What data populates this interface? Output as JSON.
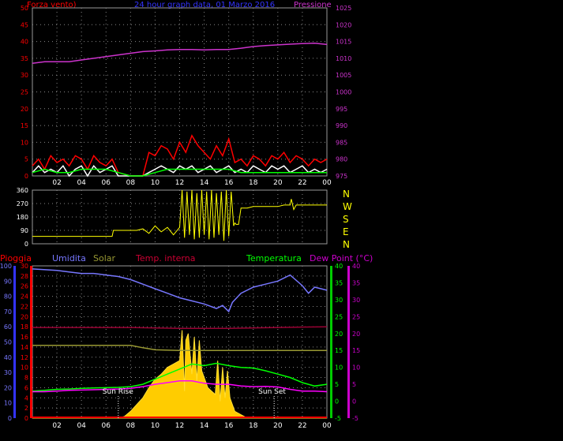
{
  "header": {
    "left_label": "Forza vento)",
    "title": "24 hour graph data, 01 Marzo 2016",
    "right_label": "Pressione"
  },
  "direction_letters": [
    "N",
    "W",
    "S",
    "E",
    "N"
  ],
  "bottom_labels": {
    "pioggia": "Pioggia",
    "umidita": "Umidita",
    "solar": "Solar",
    "temp_interna": "Temp. interna",
    "temperatura": "Temperatura",
    "dew_point": "Dew Point (°C)"
  },
  "annotations": {
    "sun_rise": "Sun Rise",
    "sun_set": "Sun Set"
  },
  "colors": {
    "wind_gust": "#ff0000",
    "wind_avg": "#ffffff",
    "wind_green": "#00ff00",
    "pressure": "#cc33cc",
    "direction": "#ffff00",
    "humidity": "#7777ff",
    "solar_line": "#999933",
    "temp_interna": "#990033",
    "temperatura": "#00ff00",
    "dew_point": "#ff00ff",
    "solar_fill": "#ffcc00",
    "rain": "#ff0000"
  },
  "chart_data": [
    {
      "type": "line",
      "name": "wind_pressure",
      "x_tick_labels": [
        "02",
        "04",
        "06",
        "08",
        "10",
        "12",
        "14",
        "16",
        "18",
        "20",
        "22",
        "00"
      ],
      "y_left_ticks": [
        "0",
        "5",
        "10",
        "15",
        "20",
        "25",
        "30",
        "35",
        "40",
        "45",
        "50"
      ],
      "y_right_ticks": [
        "975",
        "980",
        "985",
        "990",
        "995",
        "1000",
        "1005",
        "1010",
        "1015",
        "1020",
        "1025"
      ],
      "ylim_left": [
        0,
        50
      ],
      "ylim_right": [
        975,
        1025
      ],
      "xlim_hours": [
        0,
        24
      ],
      "grid": true,
      "series": [
        {
          "key": "pressure",
          "axis": "right",
          "x": [
            0,
            1,
            2,
            3,
            4,
            5,
            6,
            7,
            8,
            9,
            10,
            11,
            12,
            13,
            14,
            15,
            16,
            17,
            18,
            19,
            20,
            21,
            22,
            23,
            24
          ],
          "values": [
            1008.5,
            1009,
            1009,
            1009,
            1009.5,
            1010,
            1010.5,
            1011,
            1011.5,
            1012,
            1012.2,
            1012.5,
            1012.6,
            1012.6,
            1012.5,
            1012.6,
            1012.6,
            1013,
            1013.5,
            1013.8,
            1014,
            1014.2,
            1014.4,
            1014.5,
            1014.1
          ]
        },
        {
          "key": "wind_gust",
          "axis": "left",
          "x": [
            0,
            0.5,
            1,
            1.5,
            2,
            2.5,
            3,
            3.5,
            4,
            4.5,
            5,
            5.5,
            6,
            6.5,
            7,
            8,
            9,
            9.5,
            10,
            10.5,
            11,
            11.5,
            12,
            12.5,
            13,
            13.5,
            14,
            14.5,
            15,
            15.5,
            16,
            16.5,
            17,
            17.5,
            18,
            18.5,
            19,
            19.5,
            20,
            20.5,
            21,
            21.5,
            22,
            22.5,
            23,
            23.5,
            24
          ],
          "values": [
            3,
            5,
            2,
            6,
            4,
            5,
            3,
            6,
            5,
            2,
            6,
            4,
            3,
            5,
            1,
            0,
            0,
            7,
            6,
            9,
            8,
            5,
            10,
            7,
            12,
            9,
            7,
            5,
            9,
            6,
            11,
            4,
            5,
            3,
            6,
            5,
            3,
            6,
            5,
            7,
            4,
            6,
            5,
            3,
            5,
            4,
            5
          ]
        },
        {
          "key": "wind_avg",
          "axis": "left",
          "x": [
            0,
            0.5,
            1,
            1.5,
            2,
            2.5,
            3,
            3.5,
            4,
            4.5,
            5,
            5.5,
            6,
            6.5,
            7,
            8,
            9,
            9.5,
            10,
            10.5,
            11,
            11.5,
            12,
            12.5,
            13,
            13.5,
            14,
            14.5,
            15,
            15.5,
            16,
            16.5,
            17,
            17.5,
            18,
            18.5,
            19,
            19.5,
            20,
            20.5,
            21,
            21.5,
            22,
            22.5,
            23,
            23.5,
            24
          ],
          "values": [
            1,
            3,
            1,
            2,
            1,
            3,
            0,
            2,
            3,
            0,
            3,
            1,
            2,
            3,
            0,
            0,
            0,
            1,
            2,
            3,
            2,
            1,
            3,
            2,
            3,
            1,
            2,
            3,
            1,
            2,
            3,
            1,
            2,
            1,
            3,
            2,
            1,
            3,
            2,
            3,
            1,
            2,
            3,
            1,
            2,
            1,
            2
          ]
        },
        {
          "key": "wind_green",
          "axis": "left",
          "x": [
            0,
            1,
            2,
            3,
            4,
            5,
            6,
            7,
            8,
            9,
            10,
            11,
            12,
            13,
            14,
            15,
            16,
            17,
            18,
            19,
            20,
            21,
            22,
            23,
            24
          ],
          "values": [
            1,
            2,
            1,
            1,
            2,
            2,
            2,
            1,
            0,
            0,
            1,
            2,
            2,
            2,
            2,
            2,
            2,
            1,
            1,
            1,
            1,
            1,
            1,
            1,
            1
          ]
        }
      ]
    },
    {
      "type": "line",
      "name": "wind_direction",
      "y_ticks": [
        "0",
        "90",
        "180",
        "270",
        "360"
      ],
      "ylim": [
        0,
        360
      ],
      "xlim_hours": [
        0,
        24
      ],
      "grid": true,
      "series": [
        {
          "key": "direction",
          "x": [
            0,
            6.5,
            6.6,
            8.5,
            9,
            9.5,
            10,
            10.5,
            11,
            11.5,
            12,
            12.2,
            12.4,
            12.6,
            12.8,
            13,
            13.2,
            13.4,
            13.6,
            13.8,
            14,
            14.2,
            14.4,
            14.6,
            14.8,
            15,
            15.2,
            15.4,
            15.6,
            15.8,
            16,
            16.2,
            16.4,
            16.5,
            16.6,
            16.8,
            17,
            17.5,
            18,
            20,
            20.5,
            21,
            21.1,
            21.3,
            21.5,
            22,
            24
          ],
          "values": [
            50,
            50,
            90,
            90,
            100,
            70,
            120,
            80,
            110,
            60,
            110,
            360,
            40,
            350,
            60,
            360,
            30,
            340,
            40,
            360,
            60,
            350,
            30,
            360,
            40,
            340,
            60,
            350,
            20,
            360,
            50,
            350,
            120,
            140,
            130,
            130,
            240,
            240,
            250,
            250,
            260,
            260,
            300,
            230,
            260,
            260,
            260
          ]
        }
      ]
    },
    {
      "type": "line",
      "name": "rain_humidity_solar_temperature",
      "y_rain_ticks": [
        "0",
        "2",
        "4",
        "6",
        "8",
        "10",
        "12",
        "14",
        "16",
        "18",
        "20",
        "22",
        "24",
        "26",
        "28",
        "30"
      ],
      "y_humidity_ticks": [
        "0",
        "10",
        "20",
        "30",
        "40",
        "50",
        "60",
        "70",
        "80",
        "90",
        "100"
      ],
      "y_temp_ticks": [
        "-5",
        "0",
        "5",
        "10",
        "15",
        "20",
        "25",
        "30",
        "35",
        "40"
      ],
      "ylim_rain": [
        0,
        30
      ],
      "ylim_humidity": [
        0,
        100
      ],
      "ylim_temp": [
        -5,
        40
      ],
      "xlim_hours": [
        0,
        24
      ],
      "grid": true,
      "sun_rise_hour": 7,
      "sun_set_hour": 19.7,
      "series": [
        {
          "key": "humidity",
          "axis": "humidity",
          "x": [
            0,
            2,
            3,
            4,
            5,
            6,
            7,
            8,
            9,
            10,
            11,
            12,
            13,
            14,
            15,
            15.5,
            16,
            16.3,
            17,
            18,
            19,
            20,
            21,
            22,
            22.5,
            23,
            24
          ],
          "values": [
            98,
            97,
            96,
            95,
            95,
            94,
            93,
            91,
            88,
            85,
            82,
            79,
            77,
            75,
            72,
            74,
            70,
            76,
            82,
            86,
            88,
            90,
            94,
            87,
            82,
            86,
            84
          ]
        },
        {
          "key": "solar_line",
          "axis": "temp",
          "x": [
            0,
            4,
            8,
            9,
            10,
            12,
            14,
            16,
            18,
            20,
            22,
            24
          ],
          "values": [
            16.5,
            16.5,
            16.5,
            15.8,
            15.2,
            15,
            15,
            15,
            15,
            15,
            15,
            15
          ]
        },
        {
          "key": "temp_interna",
          "axis": "temp",
          "x": [
            0,
            4,
            8,
            12,
            16,
            20,
            24
          ],
          "values": [
            21.8,
            21.8,
            21.8,
            21.5,
            21.5,
            21.8,
            22
          ]
        },
        {
          "key": "temperatura",
          "axis": "temp",
          "x": [
            0,
            1,
            2,
            3,
            4,
            5,
            6,
            7,
            8,
            9,
            10,
            11,
            12,
            13,
            14,
            15,
            16,
            17,
            18,
            19,
            20,
            21,
            22,
            23,
            24
          ],
          "values": [
            3,
            3.2,
            3.5,
            3.6,
            3.8,
            3.9,
            4,
            4.1,
            4.3,
            5,
            6.5,
            8,
            9.5,
            11,
            10.5,
            11.2,
            10.5,
            10,
            9.8,
            9,
            8,
            7,
            5.5,
            4.5,
            5
          ]
        },
        {
          "key": "dew_point",
          "axis": "temp",
          "x": [
            0,
            1,
            2,
            3,
            4,
            5,
            6,
            7,
            8,
            9,
            10,
            11,
            12,
            13,
            14,
            15,
            16,
            17,
            18,
            19,
            20,
            21,
            22,
            23,
            24
          ],
          "values": [
            2.8,
            2.8,
            3,
            3.2,
            3.3,
            3.4,
            3.5,
            3.6,
            3.8,
            4.3,
            5,
            5.5,
            6,
            6,
            5.3,
            5,
            5,
            4.5,
            4.3,
            4.4,
            4.2,
            3.5,
            3,
            3,
            2.8
          ]
        },
        {
          "key": "solar_fill",
          "axis": "temp",
          "x": [
            0,
            7,
            7.5,
            8,
            8.5,
            9,
            9.5,
            10,
            10.5,
            11,
            11.5,
            12,
            12.2,
            12.4,
            12.5,
            12.7,
            13,
            13.2,
            13.4,
            13.6,
            13.8,
            14,
            14.3,
            14.6,
            14.9,
            15.1,
            15.3,
            15.5,
            15.7,
            15.9,
            16.1,
            16.5,
            17,
            17.5,
            18,
            24
          ],
          "values": [
            -5,
            -5,
            -4.5,
            -3,
            -1,
            1,
            4,
            6.5,
            8,
            10,
            11,
            12,
            21,
            3,
            18,
            20,
            8,
            19,
            6,
            18,
            9,
            7,
            4,
            3,
            2,
            12,
            0,
            10,
            1,
            9,
            1,
            -3,
            -4,
            -5,
            -5,
            -5
          ]
        }
      ]
    }
  ]
}
